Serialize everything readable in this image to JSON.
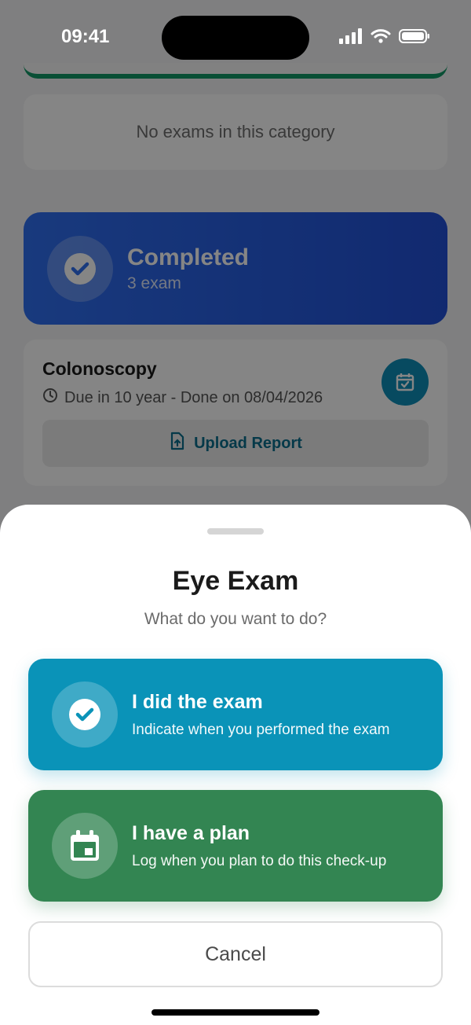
{
  "status_bar": {
    "time": "09:41"
  },
  "background": {
    "empty_message": "No exams in this category",
    "completed": {
      "title": "Completed",
      "count": "3 exam"
    },
    "exam": {
      "title": "Colonoscopy",
      "due": "Due in 10 year - Done on 08/04/2026",
      "upload_label": "Upload Report"
    }
  },
  "sheet": {
    "title": "Eye Exam",
    "subtitle": "What do you want to do?",
    "options": [
      {
        "title": "I did the exam",
        "desc": "Indicate when you performed the exam",
        "color": "#0a93b8"
      },
      {
        "title": "I have a plan",
        "desc": "Log when you plan to do this check-up",
        "color": "#338552"
      }
    ],
    "cancel_label": "Cancel"
  }
}
